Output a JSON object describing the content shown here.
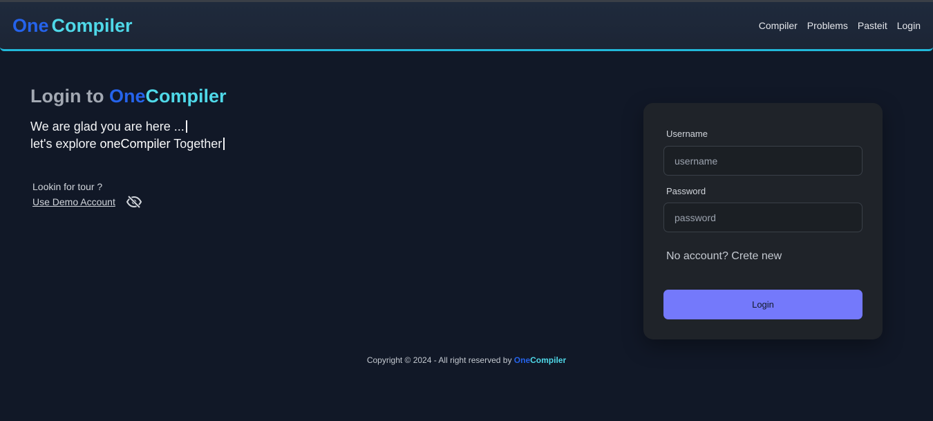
{
  "navbar": {
    "brand_one": "One",
    "brand_compiler": "Compiler",
    "links": [
      "Compiler",
      "Problems",
      "Pasteit",
      "Login"
    ]
  },
  "hero": {
    "title_prefix": "Login to ",
    "title_one": "One",
    "title_compiler": "Compiler",
    "line1": "We are glad you are here ...",
    "line2_prefix": "let's explore ",
    "line2_strong": "oneCompiler",
    "line2_suffix": " Together"
  },
  "tour": {
    "question": "Lookin for tour ?",
    "demo_link": "Use Demo Account",
    "icon": "eye-slash-icon"
  },
  "login_form": {
    "username_label": "Username",
    "username_placeholder": "username",
    "username_value": "",
    "password_label": "Password",
    "password_placeholder": "password",
    "password_value": "",
    "signup_text": "No account? Crete new",
    "submit_label": "Login"
  },
  "footer": {
    "copyright": "Copyright © 2024 - All right reserved by ",
    "brand_one": "One",
    "brand_compiler": "Compiler"
  },
  "colors": {
    "background": "#111827",
    "accent_blue": "#2563eb",
    "accent_cyan": "#4fd8e8",
    "button": "#7479fb",
    "navbar_border": "#22b8d9"
  }
}
